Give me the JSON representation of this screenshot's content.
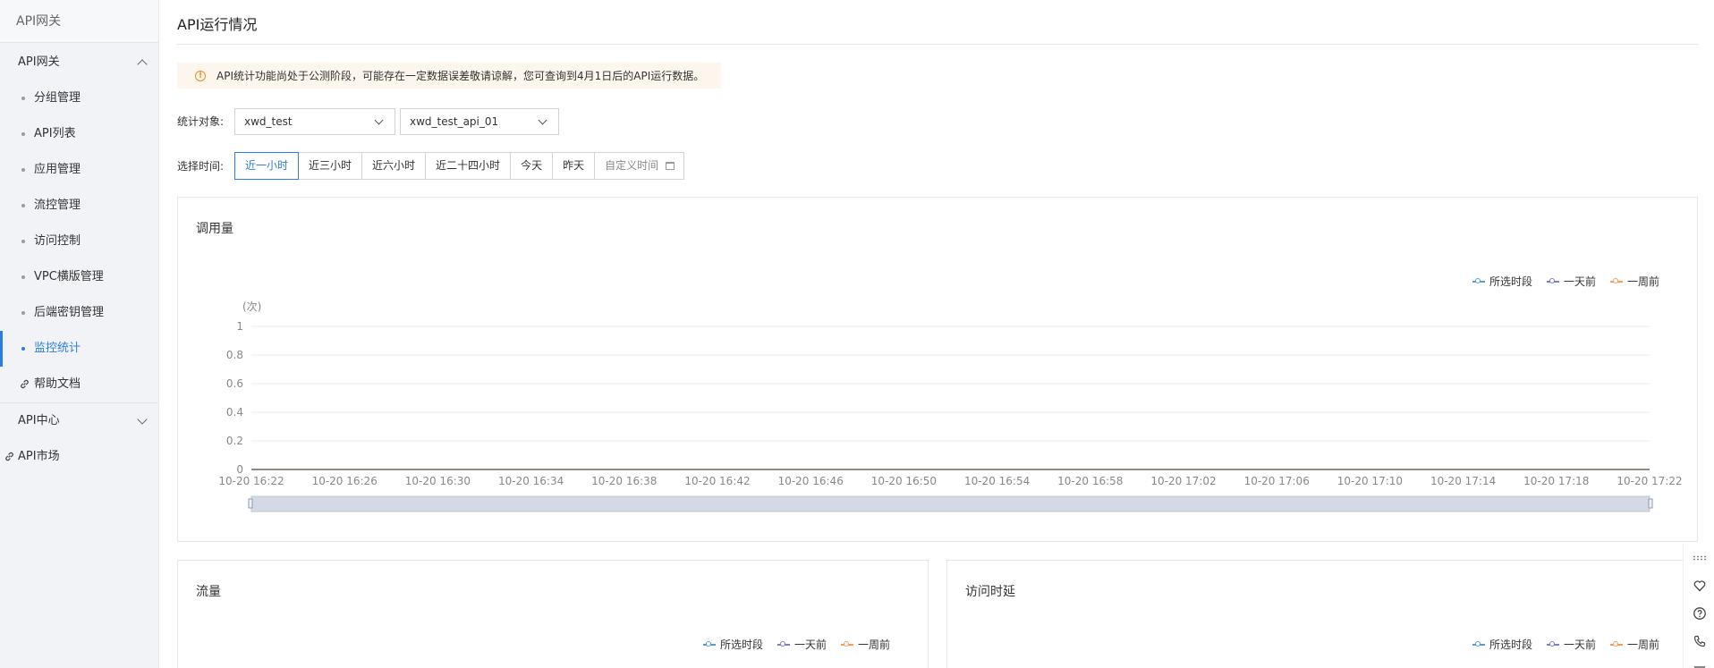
{
  "sidebar": {
    "title": "API网关",
    "gateway_group": "API网关",
    "items": [
      {
        "label": "分组管理",
        "active": false
      },
      {
        "label": "API列表",
        "active": false
      },
      {
        "label": "应用管理",
        "active": false
      },
      {
        "label": "流控管理",
        "active": false
      },
      {
        "label": "访问控制",
        "active": false
      },
      {
        "label": "VPC横版管理",
        "active": false
      },
      {
        "label": "后端密钥管理",
        "active": false
      },
      {
        "label": "监控统计",
        "active": true
      }
    ],
    "help_doc": "帮助文档",
    "api_center": "API中心",
    "api_market": "API市场"
  },
  "main": {
    "title": "API运行情况",
    "notice": "API统计功能尚处于公测阶段，可能存在一定数据误差敬请谅解，您可查询到4月1日后的API运行数据。",
    "target_label": "统计对象:",
    "group_select": "xwd_test",
    "api_select": "xwd_test_api_01",
    "time_label": "选择时间:",
    "time_ranges": [
      "近一小时",
      "近三小时",
      "近六小时",
      "近二十四小时",
      "今天",
      "昨天"
    ],
    "custom_time": "自定义时间",
    "active_range": 0
  },
  "legend": {
    "selected": "所选时段",
    "day_ago": "一天前",
    "week_ago": "一周前"
  },
  "colors": {
    "accent": "#2a7de1",
    "selected_series": "#5b9bd5",
    "day_series": "#7b7fc4",
    "week_series": "#f0a05a"
  },
  "cards": {
    "calls": "调用量",
    "traffic": "流量",
    "latency": "访问时延"
  },
  "chart_data": [
    {
      "type": "line",
      "title": "调用量",
      "ylabel": "(次)",
      "ylim": [
        0,
        1
      ],
      "y_ticks": [
        "0",
        "0.2",
        "0.4",
        "0.6",
        "0.8",
        "1"
      ],
      "categories": [
        "10-20 16:22",
        "10-20 16:26",
        "10-20 16:30",
        "10-20 16:34",
        "10-20 16:38",
        "10-20 16:42",
        "10-20 16:46",
        "10-20 16:50",
        "10-20 16:54",
        "10-20 16:58",
        "10-20 17:02",
        "10-20 17:06",
        "10-20 17:10",
        "10-20 17:14",
        "10-20 17:18",
        "10-20 17:22"
      ],
      "series": [
        {
          "name": "所选时段",
          "values": [
            0,
            0,
            0,
            0,
            0,
            0,
            0,
            0,
            0,
            0,
            0,
            0,
            0,
            0,
            0,
            0
          ]
        },
        {
          "name": "一天前",
          "values": [
            0,
            0,
            0,
            0,
            0,
            0,
            0,
            0,
            0,
            0,
            0,
            0,
            0,
            0,
            0,
            0
          ]
        },
        {
          "name": "一周前",
          "values": [
            0,
            0,
            0,
            0,
            0,
            0,
            0,
            0,
            0,
            0,
            0,
            0,
            0,
            0,
            0,
            0
          ]
        }
      ],
      "grid": true,
      "legend": "top-right"
    }
  ]
}
